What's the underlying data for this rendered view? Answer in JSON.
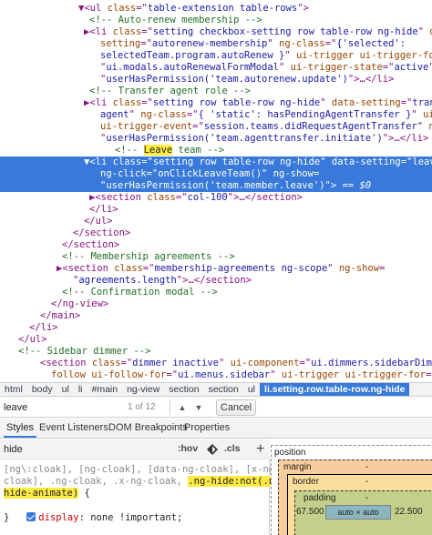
{
  "tree": {
    "lines": [
      {
        "parts": [
          {
            "c": "pu",
            "t": "▼"
          },
          {
            "c": "tag",
            "t": "<ul "
          },
          {
            "c": "an",
            "t": "class"
          },
          {
            "c": "pu",
            "t": "=\""
          },
          {
            "c": "av",
            "t": "table-extension table-rows"
          },
          {
            "c": "pu",
            "t": "\">"
          }
        ]
      },
      {
        "parts": [
          {
            "c": "cm",
            "t": "<!-- Auto-renew membership -->"
          }
        ]
      },
      {
        "parts": [
          {
            "c": "pu",
            "t": "▶"
          },
          {
            "c": "tag",
            "t": "<li "
          },
          {
            "c": "an",
            "t": "class"
          },
          {
            "c": "pu",
            "t": "=\""
          },
          {
            "c": "av",
            "t": "setting checkbox-setting row table-row ng-hide"
          },
          {
            "c": "pu",
            "t": "\" "
          },
          {
            "c": "an",
            "t": "data-"
          }
        ]
      },
      {
        "parts": [
          {
            "c": "an",
            "t": "setting"
          },
          {
            "c": "pu",
            "t": "=\""
          },
          {
            "c": "av",
            "t": "autorenew-membership"
          },
          {
            "c": "pu",
            "t": "\" "
          },
          {
            "c": "an",
            "t": "ng-class"
          },
          {
            "c": "pu",
            "t": "=\""
          },
          {
            "c": "av",
            "t": "{'selected':"
          }
        ]
      },
      {
        "parts": [
          {
            "c": "av",
            "t": "selectedTeam.program.autoRenew }"
          },
          {
            "c": "pu",
            "t": "\" "
          },
          {
            "c": "an",
            "t": "ui-trigger ui-trigger-for"
          },
          {
            "c": "pu",
            "t": "="
          }
        ]
      },
      {
        "parts": [
          {
            "c": "pu",
            "t": "\""
          },
          {
            "c": "av",
            "t": "ui.modals.autoRenewalFormModal"
          },
          {
            "c": "pu",
            "t": "\" "
          },
          {
            "c": "an",
            "t": "ui-trigger-state"
          },
          {
            "c": "pu",
            "t": "=\""
          },
          {
            "c": "av",
            "t": "active"
          },
          {
            "c": "pu",
            "t": "\" "
          },
          {
            "c": "an",
            "t": "ng-show"
          },
          {
            "c": "pu",
            "t": "="
          }
        ]
      },
      {
        "parts": [
          {
            "c": "pu",
            "t": "\""
          },
          {
            "c": "av",
            "t": "userHasPermission('team.autorenew.update')"
          },
          {
            "c": "pu",
            "t": "\">"
          },
          {
            "c": "tag",
            "t": "…</li>"
          }
        ]
      },
      {
        "parts": [
          {
            "c": "cm",
            "t": "<!-- Transfer agent role -->"
          }
        ]
      },
      {
        "parts": [
          {
            "c": "pu",
            "t": "▶"
          },
          {
            "c": "tag",
            "t": "<li "
          },
          {
            "c": "an",
            "t": "class"
          },
          {
            "c": "pu",
            "t": "=\""
          },
          {
            "c": "av",
            "t": "setting row table-row ng-hide"
          },
          {
            "c": "pu",
            "t": "\" "
          },
          {
            "c": "an",
            "t": "data-setting"
          },
          {
            "c": "pu",
            "t": "=\""
          },
          {
            "c": "av",
            "t": "transfer-"
          }
        ]
      },
      {
        "parts": [
          {
            "c": "av",
            "t": "agent"
          },
          {
            "c": "pu",
            "t": "\" "
          },
          {
            "c": "an",
            "t": "ng-class"
          },
          {
            "c": "pu",
            "t": "=\""
          },
          {
            "c": "av",
            "t": "{ 'static': hasPendingAgentTransfer }"
          },
          {
            "c": "pu",
            "t": "\" "
          },
          {
            "c": "an",
            "t": "ui-trigger"
          }
        ]
      },
      {
        "parts": [
          {
            "c": "an",
            "t": "ui-trigger-event"
          },
          {
            "c": "pu",
            "t": "=\""
          },
          {
            "c": "av",
            "t": "session.teams.didRequestAgentTransfer"
          },
          {
            "c": "pu",
            "t": "\" "
          },
          {
            "c": "an",
            "t": "ng-show"
          },
          {
            "c": "pu",
            "t": "="
          }
        ]
      },
      {
        "parts": [
          {
            "c": "pu",
            "t": "\""
          },
          {
            "c": "av",
            "t": "userHasPermission('team.agenttransfer.initiate')"
          },
          {
            "c": "pu",
            "t": "\">"
          },
          {
            "c": "tag",
            "t": "…</li>"
          }
        ]
      },
      {
        "parts": [
          {
            "c": "cm",
            "t": "<!-- "
          },
          {
            "c": "hlcm",
            "t": "Leave"
          },
          {
            "c": "cm",
            "t": " team -->"
          }
        ]
      },
      {
        "parts": [
          {
            "c": "pu",
            "t": "▼"
          },
          {
            "c": "tag",
            "t": "<li "
          },
          {
            "c": "an",
            "t": "class"
          },
          {
            "c": "pu",
            "t": "=\""
          },
          {
            "c": "av",
            "t": "setting row table-row ng-hide"
          },
          {
            "c": "pu",
            "t": "\" "
          },
          {
            "c": "an",
            "t": "data-setting"
          },
          {
            "c": "pu",
            "t": "=\""
          },
          {
            "c": "av",
            "t": "leave-team"
          },
          {
            "c": "pu",
            "t": "\""
          }
        ]
      },
      {
        "parts": [
          {
            "c": "an",
            "t": "ng-click"
          },
          {
            "c": "pu",
            "t": "=\""
          },
          {
            "c": "av",
            "t": "onClickLeaveTeam()"
          },
          {
            "c": "pu",
            "t": "\" "
          },
          {
            "c": "an",
            "t": "ng-show"
          },
          {
            "c": "pu",
            "t": "="
          }
        ]
      },
      {
        "parts": [
          {
            "c": "pu",
            "t": "\""
          },
          {
            "c": "av",
            "t": "userHasPermission('team.member.leave')"
          },
          {
            "c": "pu",
            "t": "\">"
          },
          {
            "c": "eq0",
            "t": " == $0"
          }
        ]
      },
      {
        "parts": [
          {
            "c": "pu",
            "t": "▶"
          },
          {
            "c": "tag",
            "t": "<section "
          },
          {
            "c": "an",
            "t": "class"
          },
          {
            "c": "pu",
            "t": "=\""
          },
          {
            "c": "av",
            "t": "col-100"
          },
          {
            "c": "pu",
            "t": "\">"
          },
          {
            "c": "tag",
            "t": "…</section>"
          }
        ]
      },
      {
        "parts": [
          {
            "c": "tag",
            "t": "</li>"
          }
        ]
      },
      {
        "parts": [
          {
            "c": "tag",
            "t": "</ul>"
          }
        ]
      },
      {
        "parts": [
          {
            "c": "tag",
            "t": "</section>"
          }
        ]
      },
      {
        "parts": [
          {
            "c": "tag",
            "t": "</section>"
          }
        ]
      },
      {
        "parts": [
          {
            "c": "cm",
            "t": "<!-- Membership agreements -->"
          }
        ]
      },
      {
        "parts": [
          {
            "c": "pu",
            "t": "▶"
          },
          {
            "c": "tag",
            "t": "<section "
          },
          {
            "c": "an",
            "t": "class"
          },
          {
            "c": "pu",
            "t": "=\""
          },
          {
            "c": "av",
            "t": "membership-agreements ng-scope"
          },
          {
            "c": "pu",
            "t": "\" "
          },
          {
            "c": "an",
            "t": "ng-show"
          },
          {
            "c": "pu",
            "t": "="
          }
        ]
      },
      {
        "parts": [
          {
            "c": "pu",
            "t": "\""
          },
          {
            "c": "av",
            "t": "agreements.length"
          },
          {
            "c": "pu",
            "t": "\">"
          },
          {
            "c": "tag",
            "t": "…</section>"
          }
        ]
      },
      {
        "parts": [
          {
            "c": "cm",
            "t": "<!-- Confirmation modal -->"
          }
        ]
      },
      {
        "parts": [
          {
            "c": "tag",
            "t": "</ng-view>"
          }
        ]
      },
      {
        "parts": [
          {
            "c": "tag",
            "t": "</main>"
          }
        ]
      },
      {
        "parts": [
          {
            "c": "tag",
            "t": "</li>"
          }
        ]
      },
      {
        "parts": [
          {
            "c": "tag",
            "t": "</ul>"
          }
        ]
      },
      {
        "parts": [
          {
            "c": "cm",
            "t": "<!-- Sidebar dimmer -->"
          }
        ]
      },
      {
        "parts": [
          {
            "c": "tag",
            "t": "<section "
          },
          {
            "c": "an",
            "t": "class"
          },
          {
            "c": "pu",
            "t": "=\""
          },
          {
            "c": "av",
            "t": "dimmer inactive"
          },
          {
            "c": "pu",
            "t": "\" "
          },
          {
            "c": "an",
            "t": "ui-component"
          },
          {
            "c": "pu",
            "t": "=\""
          },
          {
            "c": "av",
            "t": "ui.dimmers.sidebarDimmer"
          },
          {
            "c": "pu",
            "t": "\" "
          },
          {
            "c": "an",
            "t": "ui-"
          }
        ]
      },
      {
        "parts": [
          {
            "c": "an",
            "t": "follow ui-follow-for"
          },
          {
            "c": "pu",
            "t": "=\""
          },
          {
            "c": "av",
            "t": "ui.menus.sidebar"
          },
          {
            "c": "pu",
            "t": "\" "
          },
          {
            "c": "an",
            "t": "ui-trigger ui-trigger-for"
          },
          {
            "c": "pu",
            "t": "="
          }
        ]
      },
      {
        "parts": [
          {
            "c": "pu",
            "t": "\""
          },
          {
            "c": "av",
            "t": "ui.menus.sidebar"
          },
          {
            "c": "pu",
            "t": "\" "
          },
          {
            "c": "an",
            "t": "ui-trigger-state"
          },
          {
            "c": "pu",
            "t": "=\""
          },
          {
            "c": "av",
            "t": "inactive"
          },
          {
            "c": "pu",
            "t": "\">"
          },
          {
            "c": "tag",
            "t": "</section>"
          }
        ]
      },
      {
        "parts": [
          {
            "c": "cm",
            "t": "<!-- User menu modal -->"
          }
        ]
      },
      {
        "parts": [
          {
            "c": "tag",
            "t": "<div "
          },
          {
            "c": "an",
            "t": "class"
          },
          {
            "c": "pu",
            "t": "=\""
          },
          {
            "c": "av",
            "t": "ui modal"
          },
          {
            "c": "pu",
            "t": "\" "
          },
          {
            "c": "an",
            "t": "id"
          },
          {
            "c": "pu",
            "t": "=\""
          },
          {
            "c": "av",
            "t": "ui.modals.userMenuModal"
          },
          {
            "c": "pu",
            "t": "\" "
          },
          {
            "c": "an",
            "t": "ui-modal class"
          },
          {
            "c": "pu",
            "t": "=\""
          },
          {
            "c": "av",
            "t": "toolti"
          }
        ]
      }
    ]
  },
  "breadcrumb": [
    "html",
    "body",
    "ul",
    "li",
    "#main",
    "ng-view",
    "section",
    "section",
    "ul",
    "li.setting.row.table-row.ng-hide"
  ],
  "search": {
    "value": "leave",
    "match_count": "1 of 12",
    "up_arrow": "▲",
    "down_arrow": "▼",
    "cancel_label": "Cancel"
  },
  "subtabs": [
    "Styles",
    "Event Listeners",
    "DOM Breakpoints",
    "Properties"
  ],
  "styles": {
    "filter_value": "hide",
    "hov_label": ":hov",
    "cls_label": ".cls",
    "plus_label": "+",
    "rule_line1": "[ng\\:cloak], [ng-cloak], [data-ng-cloak], [x-ng-",
    "rule_line2a": "cloak], .ng-cloak, .x-ng-cloak, ",
    "rule_line2b": ".ng-hide:not(.ng-",
    "rule_line3a": "hide-animate)",
    "rule_line3b": " {",
    "decl_prop": "display",
    "decl_value": ": none !important;",
    "close_brace": "}"
  },
  "boxmodel": {
    "position_label": "position",
    "margin_label": "margin",
    "margin_value": "-",
    "border_label": "border",
    "border_value": "-",
    "padding_label": "padding",
    "padding_value": "-",
    "left_value": "67.500",
    "content_value": "auto × auto",
    "right_value": "22.500"
  },
  "colors": {
    "selection": "#3879d9",
    "search_highlight": "#fdeb43"
  }
}
